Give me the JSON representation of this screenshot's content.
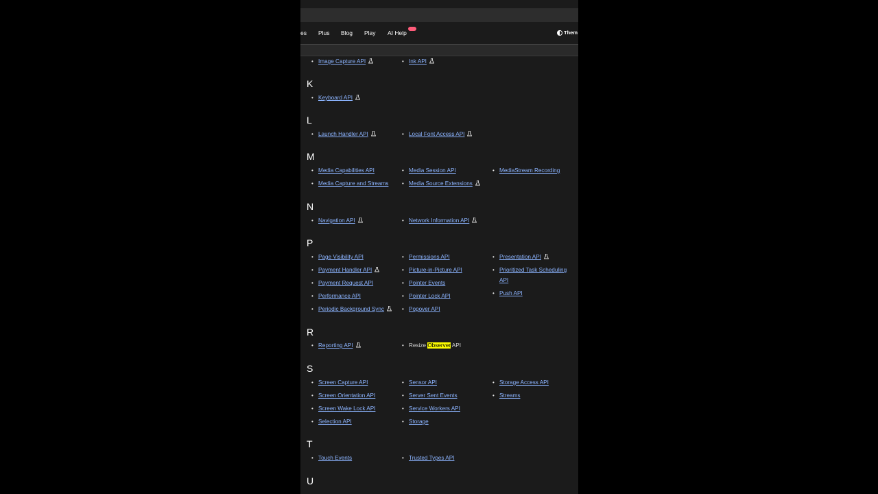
{
  "nav": {
    "partial_item": "es",
    "items": [
      "Plus",
      "Blog",
      "Play",
      "AI Help"
    ],
    "theme_label": "Them"
  },
  "sections": {
    "I": {
      "letter": "",
      "items": [
        "Image Capture API",
        "Ink API"
      ]
    },
    "K": {
      "letter": "K",
      "items": [
        "Keyboard API"
      ]
    },
    "L": {
      "letter": "L",
      "items": [
        "Launch Handler API",
        "Local Font Access API"
      ]
    },
    "M": {
      "letter": "M",
      "items": [
        "Media Capabilities API",
        "Media Capture and Streams",
        "Media Session API",
        "Media Source Extensions",
        "MediaStream Recording"
      ]
    },
    "N": {
      "letter": "N",
      "items": [
        "Navigation API",
        "Network Information API"
      ]
    },
    "P": {
      "letter": "P",
      "items": [
        "Page Visibility API",
        "Payment Handler API",
        "Payment Request API",
        "Performance API",
        "Periodic Background Sync",
        "Permissions API",
        "Picture-in-Picture API",
        "Pointer Events",
        "Pointer Lock API",
        "Popover API",
        "Presentation API",
        "Prioritized Task Scheduling",
        "API",
        "Push API"
      ]
    },
    "R": {
      "letter": "R",
      "items": [
        "Reporting API"
      ],
      "resize": {
        "before": "Resize ",
        "highlight": "Observer",
        "after": " API"
      }
    },
    "S": {
      "letter": "S",
      "items": [
        "Screen Capture API",
        "Screen Orientation API",
        "Screen Wake Lock API",
        "Selection API",
        "Sensor API",
        "Server Sent Events",
        "Service Workers API",
        "Storage",
        "Storage Access API",
        "Streams"
      ]
    },
    "T": {
      "letter": "T",
      "items": [
        "Touch Events",
        "Trusted Types API"
      ]
    },
    "U": {
      "letter": "U"
    }
  },
  "colors": {
    "link": "#8cb4ff",
    "background": "#1b1b1b",
    "highlight": "#ffff00"
  },
  "icons": {
    "experimental": "flask-icon",
    "theme": "theme-toggle-icon"
  }
}
